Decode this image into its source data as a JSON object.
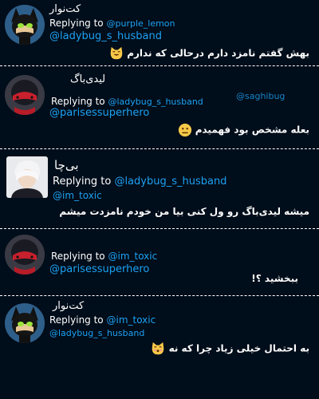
{
  "watermark": "@saghibug",
  "posts": [
    {
      "name": "کت‌نوار",
      "replying_label": "Replying to",
      "mention_1": "@purple_lemon",
      "mention_2": "@ladybug_s_husband",
      "text": "بهش گفتم نامزد دارم درحالی که ندارم",
      "emoji": "cat-grin-emoji",
      "avatar": "chat-noir-avatar"
    },
    {
      "name": "لیدی‌باگ",
      "replying_label": "Replying to",
      "mention_1": "@ladybug_s_husband",
      "mention_2": "@parisessuperhero",
      "text": "بعله مشخص بود فهمیدم",
      "emoji": "neutral-face-emoji",
      "avatar": "ladybug-avatar"
    },
    {
      "name": "بی‌چا",
      "replying_label": "Replying to",
      "mention_1": "@ladybug_s_husband",
      "mention_2": "@im_toxic",
      "text": "میشه لیدی‌باگ رو ول کنی بیا من خودم نامزدت میشم",
      "emoji": "",
      "avatar": "white-hair-boy-avatar"
    },
    {
      "name": "",
      "replying_label": "Replying to",
      "mention_1": "@im_toxic",
      "mention_2": "@parisessuperhero",
      "text": "ببخشید ؟!",
      "emoji": "",
      "avatar": "ladybug-avatar"
    },
    {
      "name": "کت‌نوار",
      "replying_label": "Replying to",
      "mention_1": "@im_toxic",
      "mention_2": "@ladybug_s_husband",
      "text": "به احتمال خیلی زیاد چرا که نه",
      "emoji": "cat-kiss-emoji",
      "avatar": "chat-noir-avatar"
    }
  ]
}
